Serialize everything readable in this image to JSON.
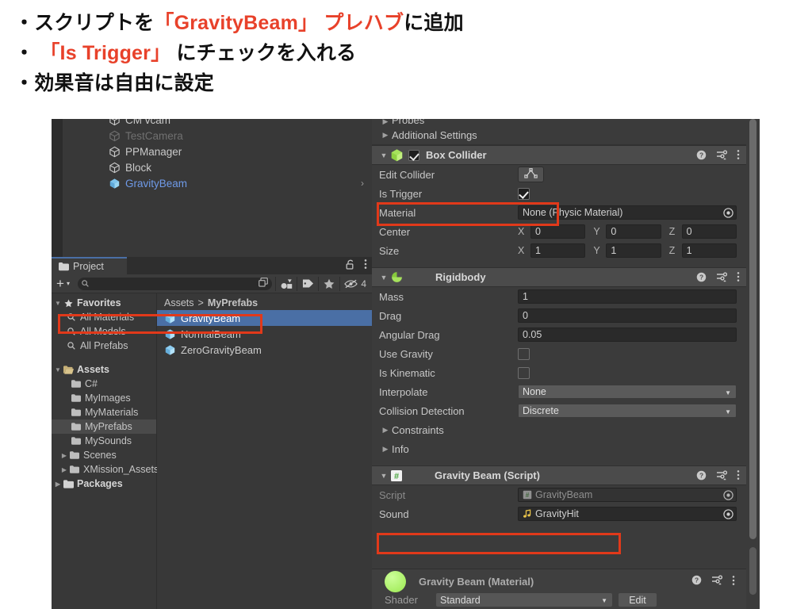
{
  "slide": {
    "lines": [
      {
        "bullet": "・",
        "segments": [
          {
            "text": "スクリプトを",
            "accent": false
          },
          {
            "text": "「GravityBeam」 プレハブ",
            "accent": true
          },
          {
            "text": "に追加",
            "accent": false
          }
        ]
      },
      {
        "bullet": "・",
        "segments": [
          {
            "text": " 「Is Trigger」 ",
            "accent": true
          },
          {
            "text": "にチェックを入れる",
            "accent": false
          }
        ]
      },
      {
        "bullet": "・",
        "segments": [
          {
            "text": "効果音は自由に設定",
            "accent": false
          }
        ]
      }
    ],
    "accent_color": "#e8412a"
  },
  "hierarchy": {
    "items": [
      {
        "label": "CM vcam",
        "state": "normal",
        "icon": "cube-outline-icon",
        "expandable": false
      },
      {
        "label": "TestCamera",
        "state": "dimmed",
        "icon": "cube-outline-icon",
        "expandable": false
      },
      {
        "label": "PPManager",
        "state": "normal",
        "icon": "cube-outline-icon",
        "expandable": false
      },
      {
        "label": "Block",
        "state": "normal",
        "icon": "cube-outline-icon",
        "expandable": false
      },
      {
        "label": "GravityBeam",
        "state": "prefab-selected",
        "icon": "cube-blue-icon",
        "expandable": true
      }
    ]
  },
  "project": {
    "tab_label": "Project",
    "tab_icon": "folder-icon",
    "lock_icon": "lock-open-icon",
    "menu_icon": "kebab-menu-icon",
    "toolbar": {
      "add_label": "+",
      "add_arrow": "▾",
      "search_placeholder": "",
      "search_value": "",
      "search_icon": "search-icon",
      "buttons": [
        {
          "name": "save-search-icon"
        },
        {
          "name": "asset-type-filter-icon"
        },
        {
          "name": "label-filter-icon"
        },
        {
          "name": "favorite-star-icon"
        },
        {
          "name": "hidden-packages-icon"
        }
      ],
      "hidden_count": "4"
    },
    "tree": [
      {
        "label": "Favorites",
        "depth": 0,
        "bold": true,
        "tri": "▼",
        "icon": "star-icon",
        "active": false
      },
      {
        "label": "All Materials",
        "depth": 1,
        "bold": false,
        "tri": "",
        "icon": "search-icon",
        "active": false
      },
      {
        "label": "All Models",
        "depth": 1,
        "bold": false,
        "tri": "",
        "icon": "search-icon",
        "active": false
      },
      {
        "label": "All Prefabs",
        "depth": 1,
        "bold": false,
        "tri": "",
        "icon": "search-icon",
        "active": false
      },
      {
        "label": "",
        "depth": 0,
        "bold": false,
        "tri": "",
        "icon": "",
        "active": false
      },
      {
        "label": "Assets",
        "depth": 0,
        "bold": true,
        "tri": "▼",
        "icon": "folder-open-icon",
        "active": false
      },
      {
        "label": "C#",
        "depth": 1,
        "bold": false,
        "tri": "",
        "icon": "folder-icon",
        "active": false
      },
      {
        "label": "MyImages",
        "depth": 1,
        "bold": false,
        "tri": "",
        "icon": "folder-icon",
        "active": false
      },
      {
        "label": "MyMaterials",
        "depth": 1,
        "bold": false,
        "tri": "",
        "icon": "folder-icon",
        "active": false
      },
      {
        "label": "MyPrefabs",
        "depth": 1,
        "bold": false,
        "tri": "",
        "icon": "folder-icon",
        "active": true
      },
      {
        "label": "MySounds",
        "depth": 1,
        "bold": false,
        "tri": "",
        "icon": "folder-icon",
        "active": false
      },
      {
        "label": "Scenes",
        "depth": 1,
        "bold": false,
        "tri": "▶",
        "icon": "folder-icon",
        "active": false
      },
      {
        "label": "XMission_Assets",
        "depth": 1,
        "bold": false,
        "tri": "▶",
        "icon": "folder-icon",
        "active": false
      },
      {
        "label": "Packages",
        "depth": 0,
        "bold": true,
        "tri": "▶",
        "icon": "folder-icon",
        "active": false
      }
    ],
    "breadcrumb": {
      "root": "Assets",
      "separator": ">",
      "current": "MyPrefabs"
    },
    "assets": [
      {
        "label": "GravityBeam",
        "icon": "prefab-cube-icon",
        "selected": true
      },
      {
        "label": "NormalBeam",
        "icon": "prefab-cube-icon",
        "selected": false
      },
      {
        "label": "ZeroGravityBeam",
        "icon": "prefab-cube-icon",
        "selected": false
      }
    ]
  },
  "inspector": {
    "top_foldouts": [
      {
        "label": "Probes",
        "tri": "▶",
        "clipped": true
      },
      {
        "label": "Additional Settings",
        "tri": "▶",
        "clipped": false
      }
    ],
    "box_collider": {
      "title": "Box Collider",
      "tri": "▼",
      "icon": "box-collider-icon",
      "enabled": true,
      "help_icon": "help-icon",
      "preset_icon": "preset-icon",
      "menu_icon": "kebab-menu-icon",
      "rows": [
        {
          "type": "button",
          "label": "Edit Collider",
          "button_icon": "edit-collider-icon"
        },
        {
          "type": "checkbox",
          "label": "Is Trigger",
          "checked": true
        },
        {
          "type": "object",
          "label": "Material",
          "value": "None (Physic Material)",
          "picker_icon": "object-picker-icon"
        },
        {
          "type": "vector3",
          "label": "Center",
          "axes": [
            "X",
            "Y",
            "Z"
          ],
          "values": [
            "0",
            "0",
            "0"
          ]
        },
        {
          "type": "vector3",
          "label": "Size",
          "axes": [
            "X",
            "Y",
            "Z"
          ],
          "values": [
            "1",
            "1",
            "1"
          ]
        }
      ]
    },
    "rigidbody": {
      "title": "Rigidbody",
      "tri": "▼",
      "icon": "rigidbody-icon",
      "help_icon": "help-icon",
      "preset_icon": "preset-icon",
      "menu_icon": "kebab-menu-icon",
      "rows": [
        {
          "type": "text",
          "label": "Mass",
          "value": "1"
        },
        {
          "type": "text",
          "label": "Drag",
          "value": "0"
        },
        {
          "type": "text",
          "label": "Angular Drag",
          "value": "0.05"
        },
        {
          "type": "checkbox",
          "label": "Use Gravity",
          "checked": false
        },
        {
          "type": "checkbox",
          "label": "Is Kinematic",
          "checked": false
        },
        {
          "type": "dropdown",
          "label": "Interpolate",
          "value": "None"
        },
        {
          "type": "dropdown",
          "label": "Collision Detection",
          "value": "Discrete"
        },
        {
          "type": "foldout",
          "label": "Constraints",
          "tri": "▶"
        },
        {
          "type": "foldout",
          "label": "Info",
          "tri": "▶"
        }
      ]
    },
    "script_component": {
      "title": "Gravity Beam (Script)",
      "tri": "▼",
      "icon": "cs-script-icon",
      "help_icon": "help-icon",
      "preset_icon": "preset-icon",
      "menu_icon": "kebab-menu-icon",
      "rows": [
        {
          "type": "object",
          "label": "Script",
          "label_dim": true,
          "value": "GravityBeam",
          "value_icon": "cs-script-icon",
          "value_dim": true,
          "picker_icon": "object-picker-icon"
        },
        {
          "type": "object",
          "label": "Sound",
          "label_dim": false,
          "value": "GravityHit",
          "value_icon": "audio-clip-icon",
          "value_dim": false,
          "picker_icon": "object-picker-icon"
        }
      ]
    },
    "material_preview": {
      "title": "Gravity Beam (Material)",
      "sphere_icon": "material-sphere-icon",
      "help_icon": "help-icon",
      "preset_icon": "preset-icon",
      "menu_icon": "kebab-menu-icon",
      "shader_label": "Shader",
      "shader_value": "Standard",
      "edit_label": "Edit"
    },
    "highlight_color": "#e1391a"
  }
}
